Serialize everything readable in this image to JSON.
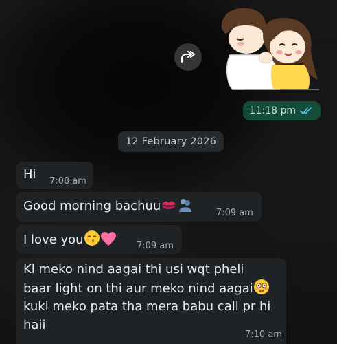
{
  "messages": [
    {
      "text": "Hi",
      "time": "7:08 am"
    },
    {
      "text": "Good morning bachuu",
      "emojis": [
        "kiss-mark",
        "people-hugging"
      ],
      "time": "7:09 am"
    },
    {
      "text": "I love you",
      "emojis": [
        "kissing-face-closed-eyes",
        "pink-heart"
      ],
      "time": "7:09 am"
    },
    {
      "lines": [
        "Kl meko nind aagai thi usi wqt pheli",
        "baar light on thi aur meko nind aagai",
        "kuki meko pata tha mera babu call pr hi",
        "haii"
      ],
      "emojis": [
        "flushed-face"
      ],
      "time": "7:10 am"
    }
  ],
  "outgoing": {
    "time": "11:18 pm",
    "status_icon": "double-check-read",
    "sticker": "hugging-couple-sticker"
  },
  "date_separator": "12 February 2026",
  "forward_icon": "forward-icon",
  "colors": {
    "incoming_bubble": "#202325",
    "outgoing_bubble": "#144d37",
    "read_ticks": "#53bdeb",
    "date_chip": "#262a2d"
  }
}
